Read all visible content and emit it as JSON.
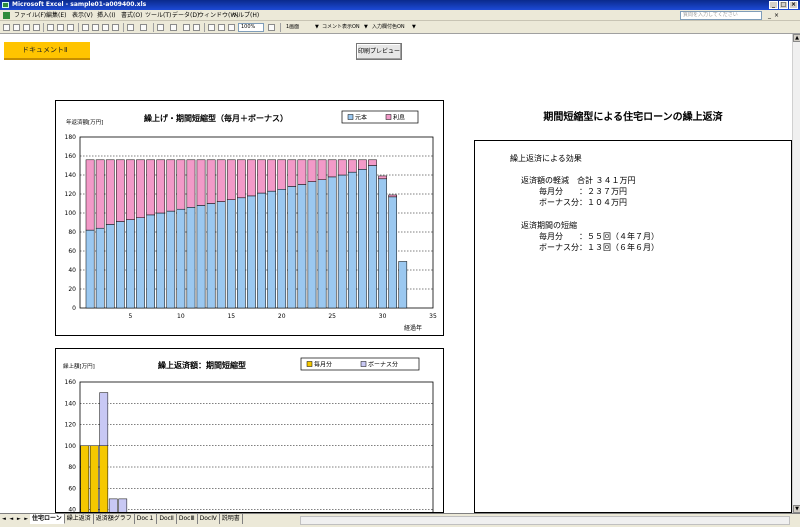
{
  "window": {
    "title": "Microsoft Excel - sample01-a009400.xls",
    "controls": [
      "_",
      "□",
      "×"
    ]
  },
  "menu": {
    "items": [
      "ファイル(F)",
      "編集(E)",
      "表示(V)",
      "挿入(I)",
      "書式(O)",
      "ツール(T)",
      "データ(D)",
      "ウィンドウ(W)",
      "ヘルプ(H)"
    ],
    "help_placeholder": "質問を入力してください",
    "mdi_controls": [
      "_",
      "×"
    ]
  },
  "toolbar": {
    "zoom": "100%",
    "page_label": "1画面",
    "comment_toggle": "コメント表示ON",
    "input_check_toggle": "入力欄付色ON"
  },
  "sheet": {
    "doc_button": "ドキュメントⅡ",
    "preview_button": "印刷プレビュー"
  },
  "summary": {
    "title": "期間短縮型による住宅ローンの繰上返済",
    "heading": "繰上返済による効果",
    "reduction_label": "返済額の軽減　合計 ３４１万円",
    "reduction_monthly": "毎月分　　：２３７万円",
    "reduction_bonus": "ボーナス分：１０４万円",
    "term_label": "返済期間の短縮",
    "term_monthly": "毎月分　　：５５回（４年７月）",
    "term_bonus": "ボーナス分：１３回（６年６月）"
  },
  "tabs": {
    "nav": "◄ ◄ ► ►",
    "items": [
      "住宅ローン",
      "繰上返済",
      "返済額グラフ",
      "Doc１",
      "DocⅡ",
      "DocⅢ",
      "DocⅣ",
      "説明書"
    ],
    "active_index": 0
  },
  "colors": {
    "principal": "#9bc8f0",
    "interest": "#f29ac8",
    "monthly": "#f5c800",
    "bonus": "#c8c8f4",
    "doc_button": "#ffc400"
  },
  "chart_data": [
    {
      "type": "bar",
      "stacked": true,
      "title": "繰上げ・期間短縮型（毎月＋ボーナス）",
      "ylabel": "年返済額[万円]",
      "xlabel": "経過年",
      "ylim": [
        0,
        180
      ],
      "xlim": [
        0,
        35
      ],
      "yticks": [
        0,
        20,
        40,
        60,
        80,
        100,
        120,
        140,
        160,
        180
      ],
      "xticks": [
        5,
        10,
        15,
        20,
        25,
        30,
        35
      ],
      "grid": true,
      "legend": "top-right",
      "x": [
        1,
        2,
        3,
        4,
        5,
        6,
        7,
        8,
        9,
        10,
        11,
        12,
        13,
        14,
        15,
        16,
        17,
        18,
        19,
        20,
        21,
        22,
        23,
        24,
        25,
        26,
        27,
        28,
        29,
        30,
        31
      ],
      "series": [
        {
          "name": "元本",
          "values": [
            82,
            84,
            88,
            91,
            93,
            95,
            98,
            100,
            102,
            104,
            106,
            108,
            110,
            112,
            114,
            116,
            118,
            121,
            123,
            125,
            128,
            130,
            133,
            135,
            138,
            140,
            143,
            146,
            150,
            136,
            117,
            49
          ]
        },
        {
          "name": "利息",
          "values": [
            74,
            72,
            68,
            65,
            63,
            61,
            58,
            56,
            54,
            52,
            50,
            48,
            46,
            44,
            42,
            40,
            38,
            35,
            33,
            31,
            28,
            26,
            23,
            21,
            18,
            16,
            13,
            10,
            6,
            3,
            2,
            0
          ]
        }
      ]
    },
    {
      "type": "bar",
      "stacked": true,
      "title": "繰上返済額：期間短縮型",
      "ylabel": "繰上額[万円]",
      "ylim": [
        0,
        160
      ],
      "yticks": [
        40,
        60,
        80,
        100,
        120,
        140,
        160
      ],
      "grid": true,
      "legend": "top-right",
      "x": [
        1,
        2,
        3,
        4,
        5
      ],
      "series": [
        {
          "name": "毎月分",
          "values": [
            100,
            100,
            100,
            0,
            0
          ]
        },
        {
          "name": "ボーナス分",
          "values": [
            0,
            0,
            50,
            50,
            50
          ]
        }
      ]
    }
  ]
}
